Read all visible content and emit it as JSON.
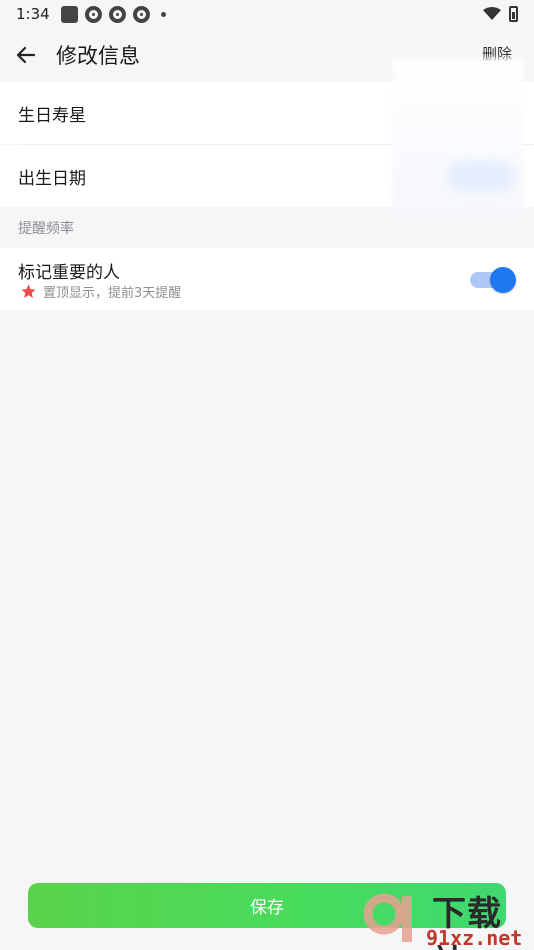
{
  "status_bar": {
    "time": "1:34",
    "icons": [
      "square-notification-icon",
      "ring-app-icon",
      "ring-app-icon",
      "ring-app-icon",
      "dot-icon",
      "wifi-icon",
      "battery-icon"
    ]
  },
  "header": {
    "title": "修改信息",
    "delete_label": "删除"
  },
  "form": {
    "birthday_person_label": "生日寿星",
    "birth_date_label": "出生日期"
  },
  "reminder": {
    "section_title": "提醒频率",
    "important_label": "标记重要的人",
    "important_hint": "置顶显示，提前3天提醒",
    "important_enabled": true
  },
  "footer": {
    "save_label": "保存"
  },
  "watermark": {
    "brand": "下载站",
    "url": "91xz.net"
  },
  "colors": {
    "background": "#f6f6f8",
    "toggle_on": "#1e78f2",
    "save_button_start": "#5ad34a",
    "save_button_end": "#3fd870",
    "star": "#ef4b4b"
  }
}
